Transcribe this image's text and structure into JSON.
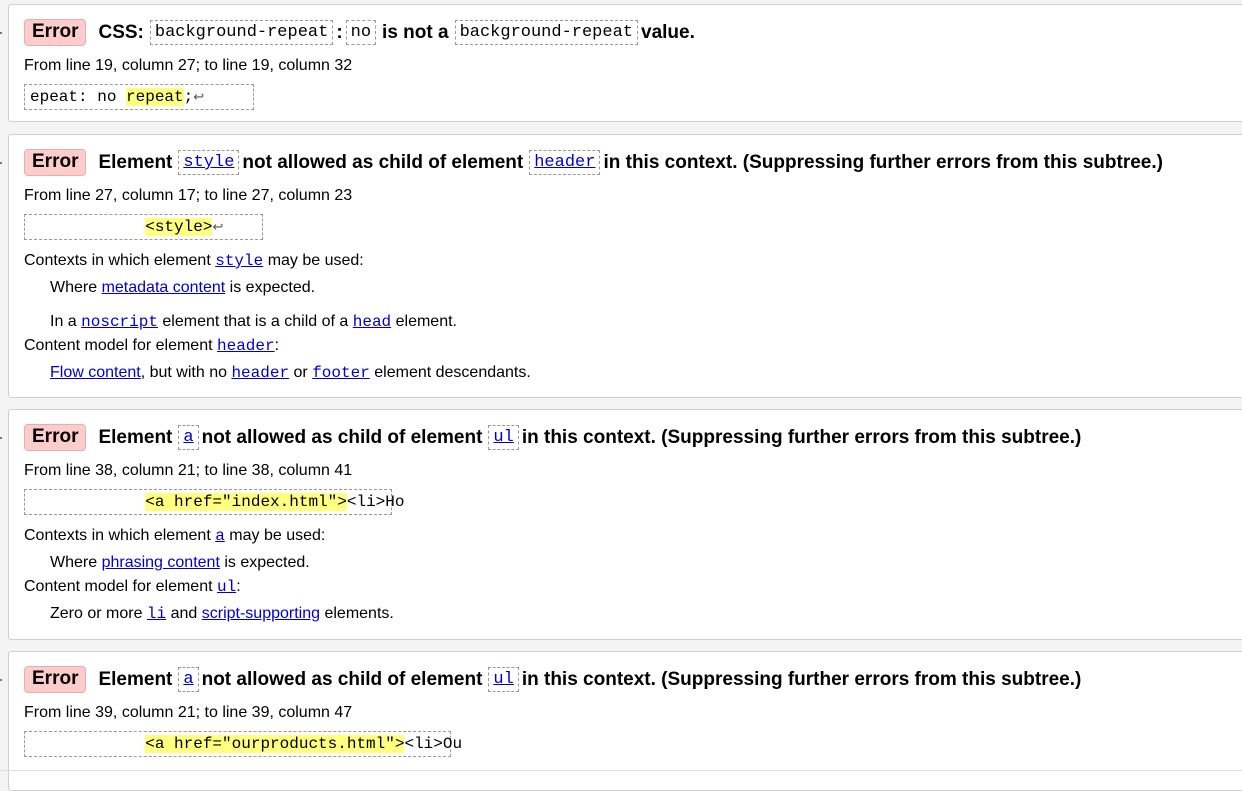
{
  "e1": {
    "badge": "Error",
    "prefix": "CSS:",
    "c1": "background-repeat",
    "colon": ":",
    "c2": "no",
    "mid": "is not a",
    "c3": "background-repeat",
    "end": "value.",
    "loc": "From line 19, column 27; to line 19, column 32",
    "ext_pre": "epeat: no ",
    "ext_hl": "repeat",
    "ext_post": ";"
  },
  "e2": {
    "badge": "Error",
    "t1": "Element",
    "c1": "style",
    "t2": "not allowed as child of element",
    "c2": "header",
    "t3": "in this context. (Suppressing further errors from this subtree.)",
    "loc": "From line 27, column 17; to line 27, column 23",
    "ext_pre": "            ",
    "ext_hl": "<style>",
    "ctx_a": "Contexts in which element",
    "ctx_code": "style",
    "ctx_b": "may be used:",
    "w1_a": "Where",
    "w1_link": "metadata content",
    "w1_b": "is expected.",
    "w2_a": "In a",
    "w2_code": "noscript",
    "w2_b": "element that is a child of a",
    "w2_code2": "head",
    "w2_c": "element.",
    "cm_a": "Content model for element",
    "cm_code": "header",
    "cm_b": ":",
    "fl_link": "Flow content",
    "fl_a": ", but with no",
    "fl_code1": "header",
    "fl_b": "or",
    "fl_code2": "footer",
    "fl_c": "element descendants."
  },
  "e3": {
    "badge": "Error",
    "t1": "Element",
    "c1": "a",
    "t2": "not allowed as child of element",
    "c2": "ul",
    "t3": "in this context. (Suppressing further errors from this subtree.)",
    "loc": "From line 38, column 21; to line 38, column 41",
    "ext_pre": "            ",
    "ext_hl": "<a href=\"index.html\">",
    "ext_post": "<li>Ho",
    "ctx_a": "Contexts in which element",
    "ctx_code": "a",
    "ctx_b": "may be used:",
    "w1_a": "Where",
    "w1_link": "phrasing content",
    "w1_b": "is expected.",
    "cm_a": "Content model for element",
    "cm_code": "ul",
    "cm_b": ":",
    "z_a": "Zero or more",
    "z_code": "li",
    "z_b": "and",
    "z_link": "script-supporting",
    "z_c": "elements."
  },
  "e4": {
    "badge": "Error",
    "t1": "Element",
    "c1": "a",
    "t2": "not allowed as child of element",
    "c2": "ul",
    "t3": "in this context. (Suppressing further errors from this subtree.)",
    "loc": "From line 39, column 21; to line 39, column 47",
    "ext_pre": "            ",
    "ext_hl": "<a href=\"ourproducts.html\">",
    "ext_post": "<li>Ou"
  },
  "return_glyph": "↩"
}
